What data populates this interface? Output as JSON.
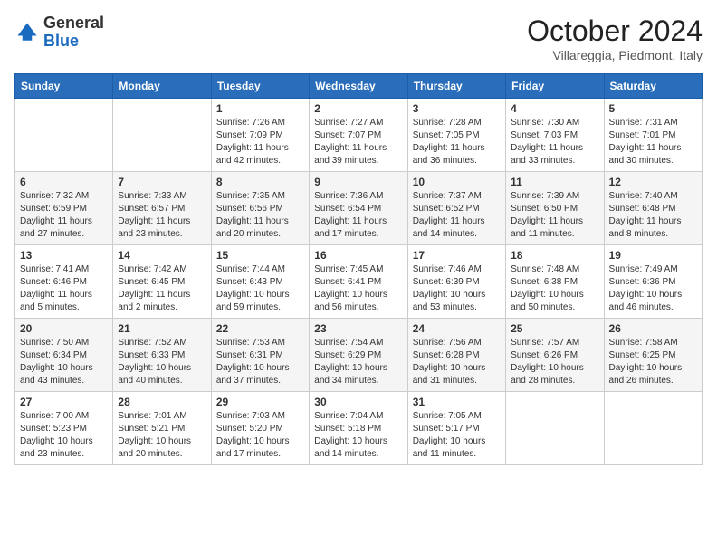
{
  "header": {
    "logo_general": "General",
    "logo_blue": "Blue",
    "month_year": "October 2024",
    "location": "Villareggia, Piedmont, Italy"
  },
  "weekdays": [
    "Sunday",
    "Monday",
    "Tuesday",
    "Wednesday",
    "Thursday",
    "Friday",
    "Saturday"
  ],
  "weeks": [
    [
      {
        "day": "",
        "info": ""
      },
      {
        "day": "",
        "info": ""
      },
      {
        "day": "1",
        "info": "Sunrise: 7:26 AM\nSunset: 7:09 PM\nDaylight: 11 hours and 42 minutes."
      },
      {
        "day": "2",
        "info": "Sunrise: 7:27 AM\nSunset: 7:07 PM\nDaylight: 11 hours and 39 minutes."
      },
      {
        "day": "3",
        "info": "Sunrise: 7:28 AM\nSunset: 7:05 PM\nDaylight: 11 hours and 36 minutes."
      },
      {
        "day": "4",
        "info": "Sunrise: 7:30 AM\nSunset: 7:03 PM\nDaylight: 11 hours and 33 minutes."
      },
      {
        "day": "5",
        "info": "Sunrise: 7:31 AM\nSunset: 7:01 PM\nDaylight: 11 hours and 30 minutes."
      }
    ],
    [
      {
        "day": "6",
        "info": "Sunrise: 7:32 AM\nSunset: 6:59 PM\nDaylight: 11 hours and 27 minutes."
      },
      {
        "day": "7",
        "info": "Sunrise: 7:33 AM\nSunset: 6:57 PM\nDaylight: 11 hours and 23 minutes."
      },
      {
        "day": "8",
        "info": "Sunrise: 7:35 AM\nSunset: 6:56 PM\nDaylight: 11 hours and 20 minutes."
      },
      {
        "day": "9",
        "info": "Sunrise: 7:36 AM\nSunset: 6:54 PM\nDaylight: 11 hours and 17 minutes."
      },
      {
        "day": "10",
        "info": "Sunrise: 7:37 AM\nSunset: 6:52 PM\nDaylight: 11 hours and 14 minutes."
      },
      {
        "day": "11",
        "info": "Sunrise: 7:39 AM\nSunset: 6:50 PM\nDaylight: 11 hours and 11 minutes."
      },
      {
        "day": "12",
        "info": "Sunrise: 7:40 AM\nSunset: 6:48 PM\nDaylight: 11 hours and 8 minutes."
      }
    ],
    [
      {
        "day": "13",
        "info": "Sunrise: 7:41 AM\nSunset: 6:46 PM\nDaylight: 11 hours and 5 minutes."
      },
      {
        "day": "14",
        "info": "Sunrise: 7:42 AM\nSunset: 6:45 PM\nDaylight: 11 hours and 2 minutes."
      },
      {
        "day": "15",
        "info": "Sunrise: 7:44 AM\nSunset: 6:43 PM\nDaylight: 10 hours and 59 minutes."
      },
      {
        "day": "16",
        "info": "Sunrise: 7:45 AM\nSunset: 6:41 PM\nDaylight: 10 hours and 56 minutes."
      },
      {
        "day": "17",
        "info": "Sunrise: 7:46 AM\nSunset: 6:39 PM\nDaylight: 10 hours and 53 minutes."
      },
      {
        "day": "18",
        "info": "Sunrise: 7:48 AM\nSunset: 6:38 PM\nDaylight: 10 hours and 50 minutes."
      },
      {
        "day": "19",
        "info": "Sunrise: 7:49 AM\nSunset: 6:36 PM\nDaylight: 10 hours and 46 minutes."
      }
    ],
    [
      {
        "day": "20",
        "info": "Sunrise: 7:50 AM\nSunset: 6:34 PM\nDaylight: 10 hours and 43 minutes."
      },
      {
        "day": "21",
        "info": "Sunrise: 7:52 AM\nSunset: 6:33 PM\nDaylight: 10 hours and 40 minutes."
      },
      {
        "day": "22",
        "info": "Sunrise: 7:53 AM\nSunset: 6:31 PM\nDaylight: 10 hours and 37 minutes."
      },
      {
        "day": "23",
        "info": "Sunrise: 7:54 AM\nSunset: 6:29 PM\nDaylight: 10 hours and 34 minutes."
      },
      {
        "day": "24",
        "info": "Sunrise: 7:56 AM\nSunset: 6:28 PM\nDaylight: 10 hours and 31 minutes."
      },
      {
        "day": "25",
        "info": "Sunrise: 7:57 AM\nSunset: 6:26 PM\nDaylight: 10 hours and 28 minutes."
      },
      {
        "day": "26",
        "info": "Sunrise: 7:58 AM\nSunset: 6:25 PM\nDaylight: 10 hours and 26 minutes."
      }
    ],
    [
      {
        "day": "27",
        "info": "Sunrise: 7:00 AM\nSunset: 5:23 PM\nDaylight: 10 hours and 23 minutes."
      },
      {
        "day": "28",
        "info": "Sunrise: 7:01 AM\nSunset: 5:21 PM\nDaylight: 10 hours and 20 minutes."
      },
      {
        "day": "29",
        "info": "Sunrise: 7:03 AM\nSunset: 5:20 PM\nDaylight: 10 hours and 17 minutes."
      },
      {
        "day": "30",
        "info": "Sunrise: 7:04 AM\nSunset: 5:18 PM\nDaylight: 10 hours and 14 minutes."
      },
      {
        "day": "31",
        "info": "Sunrise: 7:05 AM\nSunset: 5:17 PM\nDaylight: 10 hours and 11 minutes."
      },
      {
        "day": "",
        "info": ""
      },
      {
        "day": "",
        "info": ""
      }
    ]
  ]
}
